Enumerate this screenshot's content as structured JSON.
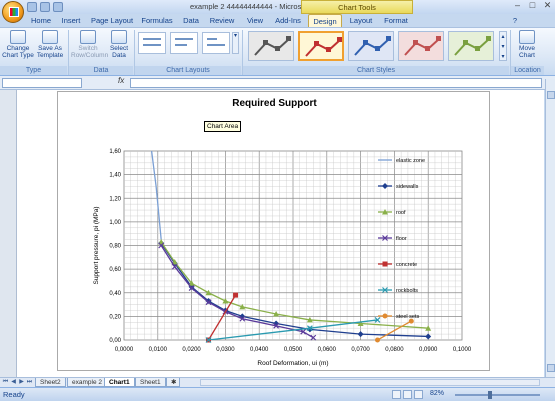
{
  "window": {
    "title": "example 2 44444444444 - Microsoft Excel",
    "context_header": "Chart Tools"
  },
  "tabs": [
    "Home",
    "Insert",
    "Page Layout",
    "Formulas",
    "Data",
    "Review",
    "View",
    "Add-Ins",
    "Design",
    "Layout",
    "Format"
  ],
  "active_tab": "Design",
  "ribbon": {
    "type_group": {
      "label": "Type",
      "change_chart_type": "Change Chart Type",
      "save_as_template": "Save As Template"
    },
    "data_group": {
      "label": "Data",
      "switch_row_column": "Switch Row/Column",
      "select_data": "Select Data"
    },
    "layouts_group": {
      "label": "Chart Layouts"
    },
    "styles_group": {
      "label": "Chart Styles"
    },
    "location_group": {
      "label": "Location",
      "move_chart": "Move Chart"
    }
  },
  "formula_bar": {
    "fx": "fx",
    "name_box": "",
    "content": ""
  },
  "chart_area_tooltip": "Chart Area",
  "chart_data": {
    "type": "line",
    "title": "Required Support",
    "xlabel": "Roof Deformation, ui (m)",
    "ylabel": "Support pressure, pi (MPa)",
    "xlim": [
      0,
      0.1
    ],
    "ylim": [
      0,
      1.6
    ],
    "x_ticks": [
      "0,0000",
      "0,0100",
      "0,0200",
      "0,0300",
      "0,0400",
      "0,0500",
      "0,0600",
      "0,0700",
      "0,0800",
      "0,0900",
      "0,1000"
    ],
    "y_ticks": [
      "0,00",
      "0,20",
      "0,40",
      "0,60",
      "0,80",
      "1,00",
      "1,20",
      "1,40",
      "1,60"
    ],
    "grid": true,
    "legend_position": "right",
    "series": [
      {
        "name": "elastic zone",
        "color": "#7a9fd4",
        "marker": "none",
        "x": [
          0.0075,
          0.0095,
          0.011
        ],
        "y": [
          1.75,
          1.3,
          0.85
        ]
      },
      {
        "name": "sidewalls",
        "color": "#1f3f8f",
        "marker": "diamond",
        "x": [
          0.011,
          0.015,
          0.02,
          0.025,
          0.03,
          0.035,
          0.045,
          0.055,
          0.07,
          0.09
        ],
        "y": [
          0.82,
          0.65,
          0.45,
          0.33,
          0.25,
          0.2,
          0.14,
          0.09,
          0.05,
          0.03
        ]
      },
      {
        "name": "roof",
        "color": "#8ab04a",
        "marker": "triangle",
        "x": [
          0.011,
          0.015,
          0.02,
          0.025,
          0.03,
          0.035,
          0.045,
          0.055,
          0.07,
          0.09
        ],
        "y": [
          0.83,
          0.66,
          0.48,
          0.4,
          0.33,
          0.28,
          0.22,
          0.17,
          0.14,
          0.1
        ]
      },
      {
        "name": "floor",
        "color": "#5a3a9a",
        "marker": "x",
        "x": [
          0.011,
          0.015,
          0.02,
          0.025,
          0.03,
          0.035,
          0.045,
          0.053,
          0.056
        ],
        "y": [
          0.8,
          0.62,
          0.44,
          0.32,
          0.24,
          0.18,
          0.12,
          0.07,
          0.02
        ]
      },
      {
        "name": "concrete",
        "color": "#c03030",
        "marker": "square",
        "x": [
          0.025,
          0.033
        ],
        "y": [
          0.0,
          0.38
        ]
      },
      {
        "name": "rockbolts",
        "color": "#2a9ab0",
        "marker": "x",
        "x": [
          0.025,
          0.055,
          0.075
        ],
        "y": [
          0.0,
          0.1,
          0.17
        ]
      },
      {
        "name": "steel sets",
        "color": "#e08a30",
        "marker": "circle",
        "x": [
          0.075,
          0.085
        ],
        "y": [
          0.0,
          0.16
        ]
      }
    ]
  },
  "sheet_tabs": [
    "Sheet2",
    "example 2",
    "Chart1",
    "Sheet1"
  ],
  "active_sheet": "Chart1",
  "status": {
    "ready": "Ready",
    "zoom": "82%"
  },
  "colors": {
    "ribbon": "#dde8f6",
    "active_tab": "#fff8d8",
    "accent": "#f0a030"
  }
}
